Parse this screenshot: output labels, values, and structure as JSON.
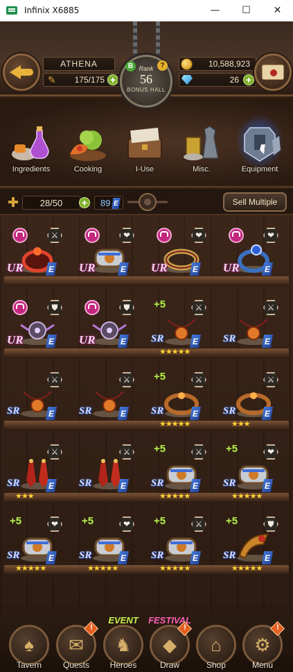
{
  "window": {
    "title": "Infinix X6885",
    "minimize": "—",
    "maximize": "☐",
    "close": "✕"
  },
  "header": {
    "player_name": "ATHENA",
    "stamina": "175/175",
    "rank_word": "Rank",
    "rank": "56",
    "rank_sub": "BONUS HALL",
    "gold": "10,588,923",
    "gems": "26",
    "badge_b": "B",
    "badge_q": "?"
  },
  "categories": [
    {
      "label": "Ingredients",
      "icon": "potion-icon"
    },
    {
      "label": "Cooking",
      "icon": "food-icon"
    },
    {
      "label": "I-Use",
      "icon": "chest-icon"
    },
    {
      "label": "Misc.",
      "icon": "misc-icon"
    },
    {
      "label": "Equipment",
      "icon": "armor-icon",
      "active": true
    }
  ],
  "counts": {
    "capacity": "28/50",
    "e_count": "89",
    "e_badge": "E",
    "sell_label": "Sell Multiple"
  },
  "rows": [
    [
      {
        "rarity": "UR",
        "locked": true,
        "tag": "sword",
        "item": "red-ring",
        "stars": ""
      },
      {
        "rarity": "UR",
        "locked": true,
        "tag": "heart",
        "item": "silver-bracer",
        "stars": ""
      },
      {
        "rarity": "UR",
        "locked": true,
        "tag": "heart",
        "item": "gold-ring",
        "stars": ""
      },
      {
        "rarity": "UR",
        "locked": true,
        "tag": "heart",
        "item": "blue-ring",
        "stars": ""
      }
    ],
    [
      {
        "rarity": "UR",
        "locked": true,
        "tag": "shield",
        "item": "purple-amulet",
        "stars": ""
      },
      {
        "rarity": "UR",
        "locked": true,
        "tag": "shield",
        "item": "purple-amulet",
        "stars": ""
      },
      {
        "rarity": "SR",
        "locked": false,
        "plus": "+5",
        "tag": "sword",
        "item": "red-pendant",
        "stars": "★★★★★"
      },
      {
        "rarity": "SR",
        "locked": false,
        "tag": "sword",
        "item": "red-pendant",
        "stars": ""
      }
    ],
    [
      {
        "rarity": "SR",
        "locked": false,
        "tag": "sword",
        "item": "red-pendant",
        "stars": ""
      },
      {
        "rarity": "SR",
        "locked": false,
        "tag": "sword",
        "item": "red-pendant",
        "stars": ""
      },
      {
        "rarity": "SR",
        "locked": false,
        "plus": "+5",
        "tag": "sword",
        "item": "bronze-ring",
        "stars": "★★★★★"
      },
      {
        "rarity": "SR",
        "locked": false,
        "tag": "sword",
        "item": "bronze-ring",
        "stars": "★★★"
      }
    ],
    [
      {
        "rarity": "SR",
        "locked": false,
        "tag": "sword",
        "item": "red-earrings",
        "stars": "★★★"
      },
      {
        "rarity": "SR",
        "locked": false,
        "tag": "sword",
        "item": "red-earrings",
        "stars": ""
      },
      {
        "rarity": "SR",
        "locked": false,
        "plus": "+5",
        "tag": "sword",
        "item": "silver-bracer",
        "stars": "★★★★★"
      },
      {
        "rarity": "SR",
        "locked": false,
        "plus": "+5",
        "tag": "heart",
        "item": "silver-bracer",
        "stars": "★★★★★"
      }
    ],
    [
      {
        "rarity": "SR",
        "locked": false,
        "plus": "+5",
        "tag": "heart",
        "item": "silver-bracer",
        "stars": "★★★★★"
      },
      {
        "rarity": "SR",
        "locked": false,
        "plus": "+5",
        "tag": "heart",
        "item": "silver-bracer",
        "stars": "★★★★★"
      },
      {
        "rarity": "SR",
        "locked": false,
        "plus": "+5",
        "tag": "sword",
        "item": "silver-bracer",
        "stars": "★★★★★"
      },
      {
        "rarity": "SR",
        "locked": false,
        "plus": "+5",
        "tag": "shield",
        "item": "gold-horn",
        "stars": "★★★★★"
      }
    ]
  ],
  "nav": [
    {
      "label": "Tavern",
      "icon": "hat-icon",
      "glyph": "♠",
      "alert": false
    },
    {
      "label": "Quests",
      "icon": "scroll-icon",
      "glyph": "✉",
      "alert": true
    },
    {
      "label": "Heroes",
      "icon": "helmet-icon",
      "glyph": "♞",
      "alert": false,
      "tag": "EVENT"
    },
    {
      "label": "Draw",
      "icon": "crystal-icon",
      "glyph": "◆",
      "alert": true,
      "tag": "FESTIVAL"
    },
    {
      "label": "Shop",
      "icon": "shop-icon",
      "glyph": "⌂",
      "alert": false
    },
    {
      "label": "Menu",
      "icon": "gear-icon",
      "glyph": "⚙",
      "alert": true
    }
  ],
  "colors": {
    "ur": "#c2277f",
    "sr": "#3b5bd0",
    "gold": "#ffd23a",
    "upgrade": "#b9ef4d",
    "equipment_glow": "#2f6bff"
  }
}
